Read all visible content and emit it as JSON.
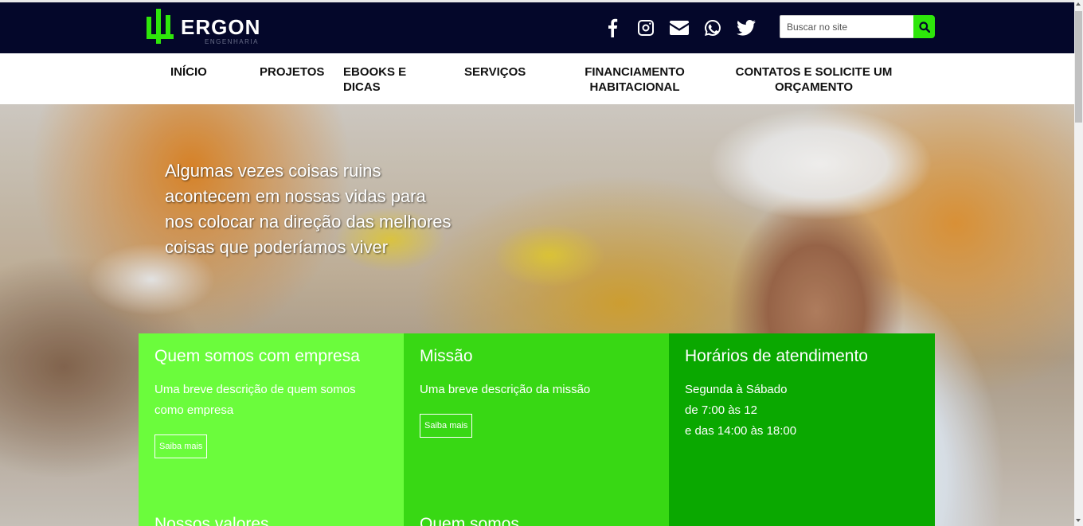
{
  "header": {
    "logo_text": "ERGON",
    "logo_subtext": "ENGENHARIA",
    "social_icons": [
      "facebook-icon",
      "instagram-icon",
      "envelope-icon",
      "whatsapp-icon",
      "twitter-icon"
    ],
    "search": {
      "placeholder": "Buscar no site",
      "button_icon": "search-icon"
    },
    "colors": {
      "bar": "#04072a",
      "accent": "#2ee60a"
    }
  },
  "nav": {
    "items": [
      {
        "label": "INÍCIO"
      },
      {
        "label": "PROJETOS"
      },
      {
        "label": "EBOOKS E DICAS"
      },
      {
        "label": "SERVIÇOS"
      },
      {
        "label": "FINANCIAMENTO HABITACIONAL"
      },
      {
        "label": "CONTATOS E SOLICITE UM ORÇAMENTO"
      }
    ]
  },
  "hero": {
    "quote": "Algumas vezes coisas ruins acontecem em nossas vidas para nos colocar na direção das melhores coisas que poderíamos viver"
  },
  "cards": [
    {
      "title": "Quem somos com empresa",
      "text": "Uma breve descrição de quem somos como empresa",
      "button": "Saiba mais",
      "color": "#6bfc3c"
    },
    {
      "title": "Missão",
      "text": "Uma breve descrição da missão",
      "button": "Saiba mais",
      "color": "#38d814"
    },
    {
      "title": "Horários de atendimento",
      "lines": [
        "Segunda à Sábado",
        "de 7:00 às 12",
        "e das 14:00 às 18:00"
      ],
      "color": "#0aa800"
    }
  ],
  "cards_below": [
    "Nossos valores",
    "Quem somos"
  ]
}
